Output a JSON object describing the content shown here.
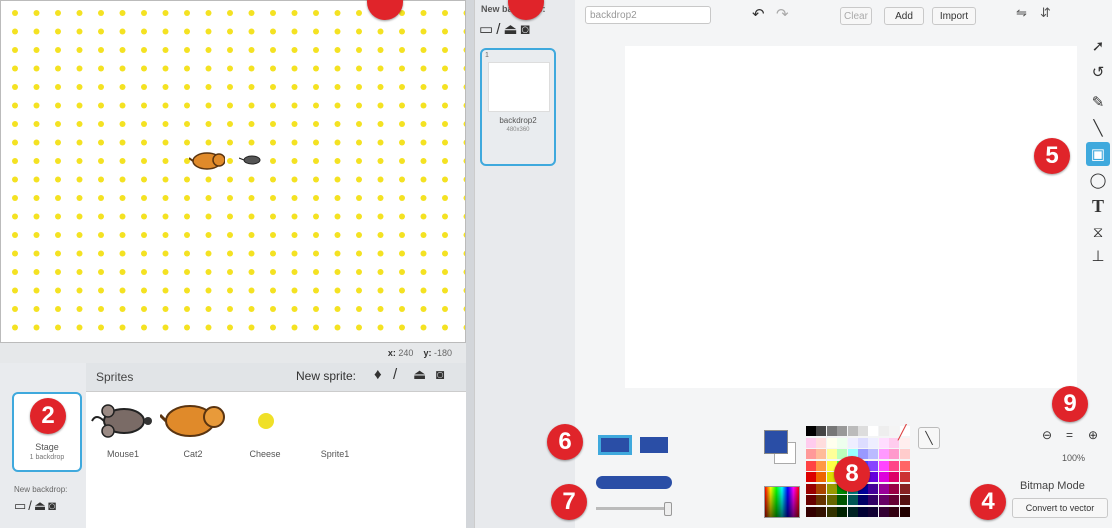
{
  "stage": {
    "coord_x_label": "x:",
    "coord_x": "240",
    "coord_y_label": "y:",
    "coord_y": "-180",
    "dot_color": "#f4e222"
  },
  "sprites": {
    "header": "Sprites",
    "new_sprite_label": "New sprite:",
    "items": [
      {
        "name": "Mouse1"
      },
      {
        "name": "Cat2"
      },
      {
        "name": "Cheese"
      },
      {
        "name": "Sprite1"
      }
    ],
    "stage_thumb_label": "Stage",
    "stage_thumb_sub": "1 backdrop",
    "new_backdrop_label": "New backdrop:"
  },
  "costumes": {
    "new_backdrop_label": "New backdrop:",
    "thumb_index": "1",
    "thumb_name": "backdrop2",
    "thumb_size": "480x360"
  },
  "editor": {
    "name_value": "backdrop2",
    "clear_label": "Clear",
    "add_label": "Add",
    "import_label": "Import",
    "zoom_level": "100%",
    "mode_label": "Bitmap Mode",
    "convert_label": "Convert to vector",
    "primary_color": "#2a4ea6",
    "secondary_color": "#ffffff"
  },
  "badges": [
    "2",
    "4",
    "5",
    "6",
    "7",
    "8",
    "9"
  ],
  "colors": {
    "accent": "#3fa9dd",
    "badge": "#e0242a"
  }
}
